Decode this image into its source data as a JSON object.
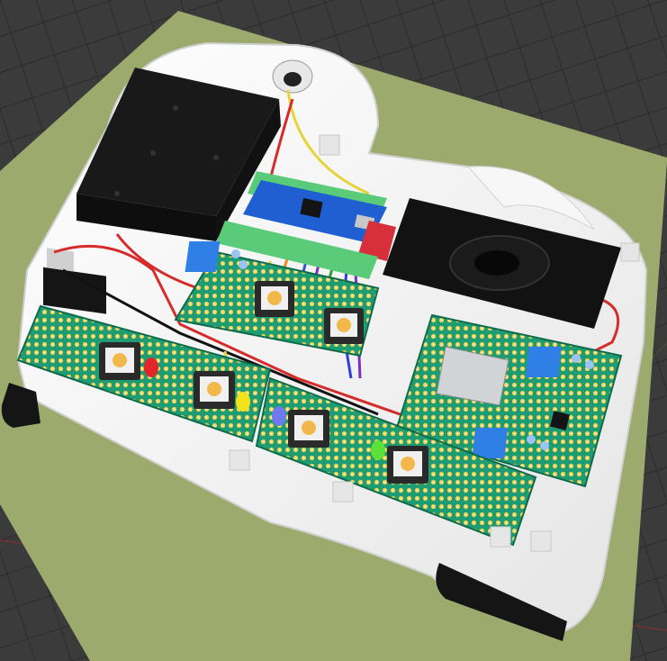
{
  "scene": {
    "kind": "3d-viewport-render",
    "background_color": "#3a3a3a",
    "grid_color": "#2e2e2e",
    "ground_plane_color": "#9aaa6c",
    "enclosure_color": "#f2f2f2",
    "pcb_color": "#1f9a72",
    "components": {
      "battery_holder": "black-box",
      "microcontroller_board": "blue-board",
      "speaker": "black-speaker",
      "audio_module": "grey-module",
      "buttons": 6,
      "leds": [
        "red",
        "yellow",
        "blue",
        "green"
      ],
      "terminal_blocks": 3
    }
  }
}
